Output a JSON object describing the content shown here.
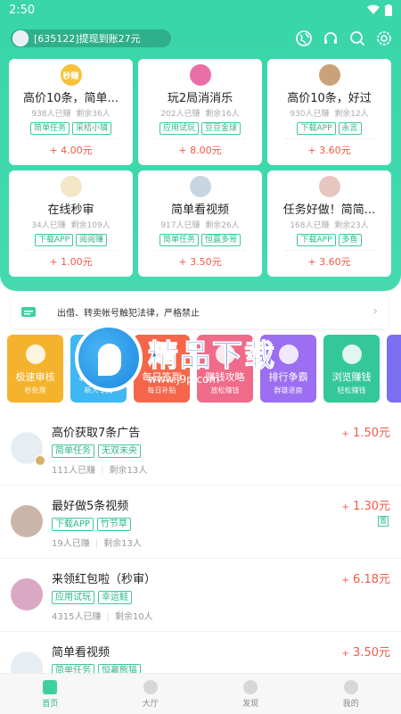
{
  "status": {
    "time": "2:50"
  },
  "header": {
    "notice": "[635122]提现到账27元",
    "icons": [
      "globe-icon",
      "headset-icon",
      "search-icon",
      "settings-icon"
    ]
  },
  "task_cards": [
    {
      "title": "高价10条，简单...",
      "done": "938人已赚",
      "left": "剩余36人",
      "tags": [
        "简单任务",
        "采桔小镇"
      ],
      "price": "4.00元",
      "logo_color": "#f7c23a",
      "logo_text": "秒赚"
    },
    {
      "title": "玩2局消消乐",
      "done": "202人已赚",
      "left": "剩余16人",
      "tags": [
        "应用试玩",
        "豆豆金球"
      ],
      "price": "8.00元",
      "logo_color": "#e96fa8",
      "logo_text": ""
    },
    {
      "title": "高价10条，好过",
      "done": "930人已赚",
      "left": "剩余12人",
      "tags": [
        "下载APP",
        "永言"
      ],
      "price": "3.60元",
      "logo_color": "#c9a27a",
      "logo_text": ""
    },
    {
      "title": "在线秒审",
      "done": "34人已赚",
      "left": "剩余109人",
      "tags": [
        "下载APP",
        "阅阅赚"
      ],
      "price": "1.00元",
      "logo_color": "#f3e7c8",
      "logo_text": ""
    },
    {
      "title": "简单看视频",
      "done": "917人已赚",
      "left": "剩余26人",
      "tags": [
        "简单任务",
        "恒赢多哥"
      ],
      "price": "3.50元",
      "logo_color": "#c8d6e2",
      "logo_text": ""
    },
    {
      "title": "任务好做！简简...",
      "done": "168人已赚",
      "left": "剩余23人",
      "tags": [
        "下载APP",
        "多鱼"
      ],
      "price": "3.60元",
      "logo_color": "#e7c6c0",
      "logo_text": ""
    }
  ],
  "price_prefix": "+",
  "announcement": "出借、转卖帐号触犯法律，严格禁止",
  "features": [
    {
      "label": "极速审核",
      "sub": "秒处理",
      "color": "#f5b32d"
    },
    {
      "label": "新手福利",
      "sub": "新人专属",
      "color": "#3fb7f2"
    },
    {
      "label": "每日签到",
      "sub": "每日补贴",
      "color": "#f5664a"
    },
    {
      "label": "赚钱攻略",
      "sub": "放松赚钱",
      "color": "#f06a8a"
    },
    {
      "label": "排行争霸",
      "sub": "群雄逐鹿",
      "color": "#9b6ef2"
    },
    {
      "label": "浏览赚钱",
      "sub": "轻松赚钱",
      "color": "#34c79a"
    },
    {
      "label": "",
      "sub": "",
      "color": "#7b6ef0"
    }
  ],
  "watermark": {
    "text": "精品下载",
    "url": "www.j9p.com"
  },
  "tasks": [
    {
      "title": "高价获取7条广告",
      "tags": [
        "简单任务",
        "无双未央"
      ],
      "done": "111人已赚",
      "left": "剩余13人",
      "price": "1.50元",
      "extra": ""
    },
    {
      "title": "最好做5条视频",
      "tags": [
        "下载APP",
        "竹节草"
      ],
      "done": "19人已赚",
      "left": "剩余13人",
      "price": "1.30元",
      "extra": "置"
    },
    {
      "title": "来领红包啦（秒审）",
      "tags": [
        "应用试玩",
        "幸运鲑"
      ],
      "done": "4315人已赚",
      "left": "剩余10人",
      "price": "6.18元",
      "extra": ""
    },
    {
      "title": "简单看视频",
      "tags": [
        "简单任务",
        "恒赢熊猫"
      ],
      "done": "",
      "left": "",
      "price": "3.50元",
      "extra": ""
    }
  ],
  "tabbar": [
    {
      "label": "首页",
      "active": true
    },
    {
      "label": "大厅",
      "active": false
    },
    {
      "label": "发现",
      "active": false
    },
    {
      "label": "我的",
      "active": false
    }
  ]
}
